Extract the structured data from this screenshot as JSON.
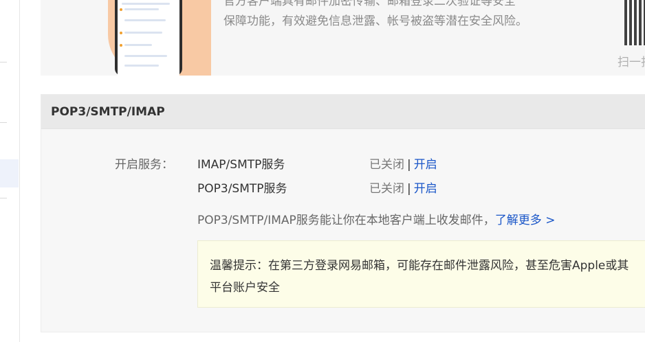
{
  "promo": {
    "line1": "官方客户端具有邮件加密传输、邮箱登录二次验证等安全",
    "line2": "保障功能，有效避免信息泄露、帐号被盗等潜在安全风险。",
    "qr_label": "扫一扫"
  },
  "section": {
    "title": "POP3/SMTP/IMAP",
    "service_label": "开启服务：",
    "services": [
      {
        "name": "IMAP/SMTP服务",
        "status": "已关闭",
        "separator": "|",
        "action": "开启"
      },
      {
        "name": "POP3/SMTP服务",
        "status": "已关闭",
        "separator": "|",
        "action": "开启"
      }
    ],
    "description": "POP3/SMTP/IMAP服务能让你在本地客户端上收发邮件，",
    "learn_more": "了解更多 >",
    "tip_line1": "温馨提示：在第三方登录网易邮箱，可能存在邮件泄露风险，甚至危害Apple或其",
    "tip_line2": "平台账户安全"
  }
}
